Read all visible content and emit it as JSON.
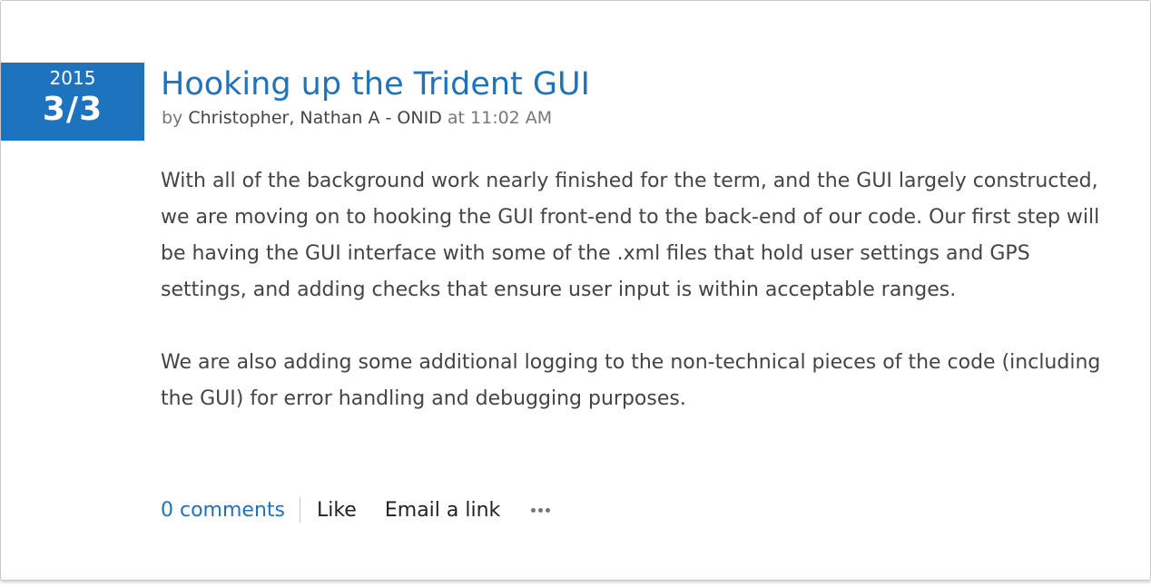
{
  "post": {
    "date": {
      "year": "2015",
      "day": "3/3"
    },
    "title": "Hooking up the Trident GUI",
    "byline": {
      "prefix": "by",
      "author": "Christopher, Nathan A - ONID",
      "at": "at",
      "time": "11:02 AM"
    },
    "body": [
      "With all of the background work nearly finished for the term, and the GUI largely constructed, we are moving on to hooking the GUI front-end to the back-end of our code. Our first step will be having the GUI interface with some of the .xml files that hold user settings and GPS settings, and adding checks that ensure user input is within acceptable ranges.",
      "We are also adding some additional logging to the non-technical pieces of the code (including the GUI) for error handling and debugging purposes."
    ]
  },
  "actions": {
    "comments": "0 comments",
    "like": "Like",
    "email": "Email a link",
    "more_icon": "ellipsis-icon"
  },
  "colors": {
    "accent": "#1e73be",
    "body_text": "#444444",
    "meta_text": "#777777"
  }
}
